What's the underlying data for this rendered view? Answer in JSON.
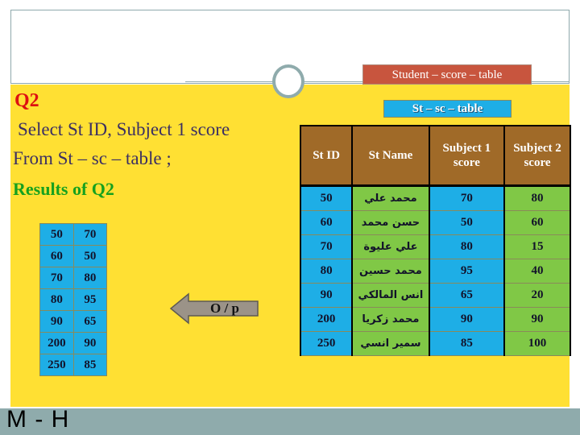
{
  "slide": {
    "footer_text": "M - H"
  },
  "header": {
    "student_score_table_chip": "Student – score – table"
  },
  "content": {
    "question_label": "Q2",
    "sql_line_1": "Select  St ID, Subject 1 score",
    "sql_line_2": "From St – sc – table ;",
    "results_label": "Results of Q2",
    "arrow_label": "O / p",
    "st_sc_table_chip": "St – sc – table"
  },
  "results_table": {
    "rows": [
      [
        "50",
        "70"
      ],
      [
        "60",
        "50"
      ],
      [
        "70",
        "80"
      ],
      [
        "80",
        "95"
      ],
      [
        "90",
        "65"
      ],
      [
        "200",
        "90"
      ],
      [
        "250",
        "85"
      ]
    ]
  },
  "main_table": {
    "headers": [
      "St ID",
      "St Name",
      "Subject 1 score",
      "Subject 2 score"
    ],
    "rows": [
      [
        "50",
        "محمد علي",
        "70",
        "80"
      ],
      [
        "60",
        "حسن محمد",
        "50",
        "60"
      ],
      [
        "70",
        "علي عليوة",
        "80",
        "15"
      ],
      [
        "80",
        "محمد حسين",
        "95",
        "40"
      ],
      [
        "90",
        "انس المالكي",
        "65",
        "20"
      ],
      [
        "200",
        "محمد زكريا",
        "90",
        "90"
      ],
      [
        "250",
        "سمير انسي",
        "85",
        "100"
      ]
    ]
  },
  "colors": {
    "panel_yellow": "#ffe033",
    "footer_teal": "#8fabac",
    "chip_red": "#c8553e",
    "chip_blue": "#1eaee6",
    "header_brown": "#a06a28",
    "cell_blue": "#1eaee6",
    "cell_green": "#80c846",
    "question_red": "#dd1111",
    "results_green": "#16a11e",
    "sql_purple": "#3b2f63"
  }
}
